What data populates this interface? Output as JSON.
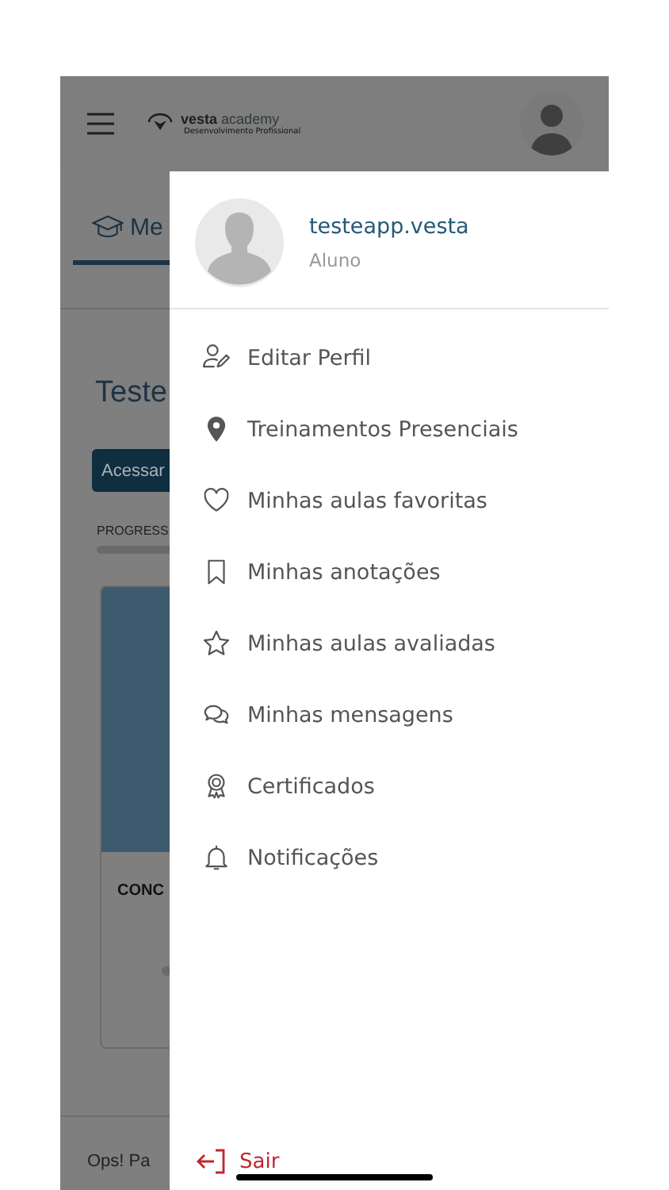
{
  "header": {
    "logo": {
      "name": "vesta",
      "name_suffix": "academy",
      "tagline": "Desenvolvimento Profissional"
    }
  },
  "background": {
    "tab": "Me",
    "course_title": "Teste",
    "access_button": "Acessar",
    "progress_label": "PROGRESS",
    "card_title": "CONC",
    "footer_text": "Ops! Pa"
  },
  "drawer": {
    "user": {
      "name": "testeapp.vesta",
      "role": "Aluno"
    },
    "items": [
      {
        "label": "Editar Perfil"
      },
      {
        "label": "Treinamentos Presenciais"
      },
      {
        "label": "Minhas aulas favoritas"
      },
      {
        "label": "Minhas anotações"
      },
      {
        "label": "Minhas aulas avaliadas"
      },
      {
        "label": "Minhas mensagens"
      },
      {
        "label": "Certificados"
      },
      {
        "label": "Notificações"
      }
    ],
    "logout": "Sair"
  }
}
